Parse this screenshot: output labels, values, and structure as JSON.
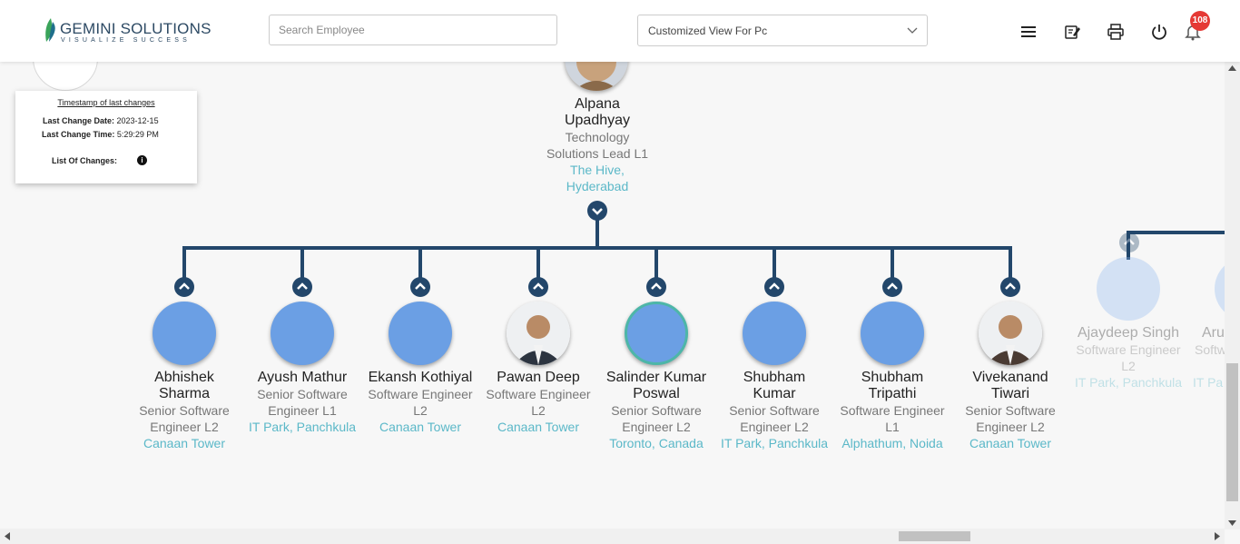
{
  "header": {
    "logo_main": "GEMINI SOLUTIONS",
    "logo_tagline": "VISUALIZE SUCCESS",
    "search_placeholder": "Search Employee",
    "view_select": "Customized View For Pc",
    "notification_count": "108"
  },
  "timestamp_panel": {
    "title": "Timestamp of last changes",
    "date_label": "Last Change Date:",
    "date_value": "2023-12-15",
    "time_label": "Last Change Time:",
    "time_value": "5:29:29 PM",
    "changes_label": "List Of Changes:"
  },
  "manager": {
    "name_line1": "Alpana",
    "name_line2": "Upadhyay",
    "title_line1": "Technology",
    "title_line2": "Solutions Lead L1",
    "loc_line1": "The Hive,",
    "loc_line2": "Hyderabad"
  },
  "reports": [
    {
      "lines": [
        "Abhishek",
        "Sharma"
      ],
      "title": [
        "Senior Software",
        "Engineer L2"
      ],
      "loc": "Canaan Tower"
    },
    {
      "lines": [
        "Ayush Mathur"
      ],
      "title": [
        "Senior Software",
        "Engineer L1"
      ],
      "loc": "IT Park, Panchkula"
    },
    {
      "lines": [
        "Ekansh Kothiyal"
      ],
      "title": [
        "Software Engineer",
        "L2"
      ],
      "loc": "Canaan Tower"
    },
    {
      "lines": [
        "Pawan Deep"
      ],
      "title": [
        "Software Engineer",
        "L2"
      ],
      "loc": "Canaan Tower"
    },
    {
      "lines": [
        "Salinder Kumar",
        "Poswal"
      ],
      "title": [
        "Senior Software",
        "Engineer L2"
      ],
      "loc": "Toronto, Canada"
    },
    {
      "lines": [
        "Shubham",
        "Kumar"
      ],
      "title": [
        "Senior Software",
        "Engineer L2"
      ],
      "loc": "IT Park, Panchkula"
    },
    {
      "lines": [
        "Shubham",
        "Tripathi"
      ],
      "title": [
        "Software Engineer",
        "L1"
      ],
      "loc": "Alphathum, Noida"
    },
    {
      "lines": [
        "Vivekanand",
        "Tiwari"
      ],
      "title": [
        "Senior Software",
        "Engineer L2"
      ],
      "loc": "Canaan Tower"
    }
  ],
  "faded_node": {
    "name": "Ajaydeep Singh",
    "title_line1": "Software Engineer",
    "title_line2": "L2",
    "loc": "IT Park, Panchkula",
    "partial_name": "Aru",
    "partial_title": "Softw",
    "partial_loc": "IT Pa"
  },
  "colors": {
    "connector": "#23476b",
    "avatar": "#6b9fe4",
    "location": "#5bb8c8",
    "badge": "#e53935"
  }
}
